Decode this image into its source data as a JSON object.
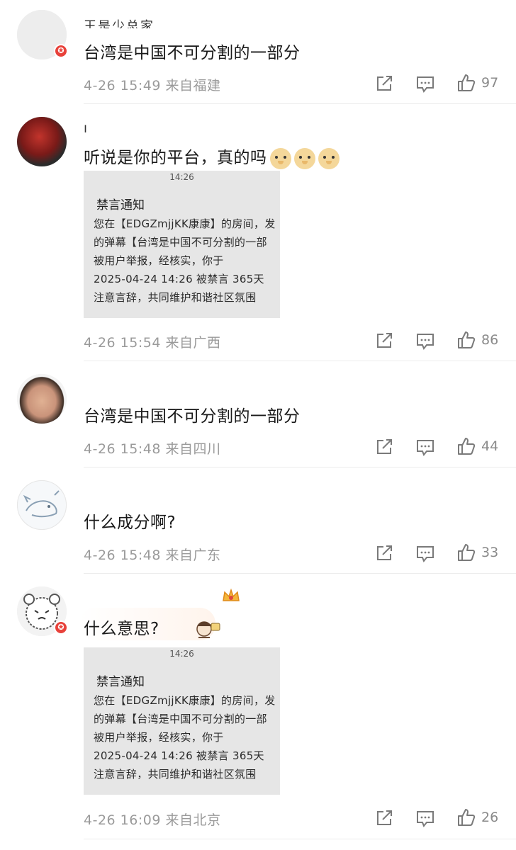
{
  "comments": [
    {
      "username": "王是少总家",
      "text": "台湾是中国不可分割的一部分",
      "time": "4-26 15:49",
      "location": "来自福建",
      "likes": "97",
      "badge": "✪"
    },
    {
      "username": "l",
      "text": "听说是你的平台，真的吗",
      "time": "4-26 15:54",
      "location": "来自广西",
      "likes": "86",
      "emoji": "doge",
      "screenshot": {
        "time": "14:26",
        "title": "禁言通知",
        "lines": [
          "您在【EDGZmjjKK康康】的房间，发",
          "的弹幕【台湾是中国不可分割的一部",
          "被用户举报，经核实，你于",
          "2025-04-24 14:26 被禁言 365天",
          "注意言辞，共同维护和谐社区氛围"
        ]
      }
    },
    {
      "username": ".",
      "text": "台湾是中国不可分割的一部分",
      "time": "4-26 15:48",
      "location": "来自四川",
      "likes": "44"
    },
    {
      "username": "",
      "text": "什么成分啊?",
      "time": "4-26 15:48",
      "location": "来自广东",
      "likes": "33"
    },
    {
      "username": "",
      "text": "什么意思?",
      "time": "4-26 16:09",
      "location": "来自北京",
      "likes": "26",
      "badge": "✪",
      "screenshot": {
        "time": "14:26",
        "title": "禁言通知",
        "lines": [
          "您在【EDGZmjjKK康康】的房间，发",
          "的弹幕【台湾是中国不可分割的一部",
          "被用户举报，经核实，你于",
          "2025-04-24 14:26 被禁言 365天",
          "注意言辞，共同维护和谐社区氛围"
        ]
      }
    }
  ],
  "icons": {
    "share": "share-icon",
    "comment": "comment-icon",
    "like": "like-icon"
  },
  "colors": {
    "badge": "#e8413a",
    "meta": "#9a9a9a"
  }
}
